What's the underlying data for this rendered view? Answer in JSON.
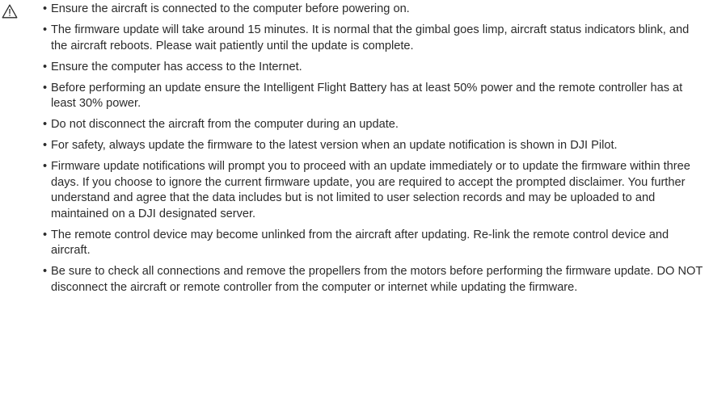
{
  "icon": "warning-triangle-icon",
  "notes": [
    "Ensure the aircraft is connected to the computer before powering on.",
    "The firmware update will take around 15 minutes. It is normal that the gimbal goes limp, aircraft status indicators blink, and the aircraft reboots. Please wait patiently until the update is complete.",
    "Ensure the computer has access to the Internet.",
    "Before performing an update ensure the Intelligent Flight Battery has at least 50% power and the remote controller has at least 30% power.",
    "Do not disconnect the aircraft from the computer during an update.",
    "For safety, always update the firmware to the latest version when an update notification is shown in DJI Pilot.",
    "Firmware update notifications will prompt you to proceed with an update immediately or to update the firmware within three days. If you choose to ignore the current firmware update, you are required to accept the prompted disclaimer. You further understand and agree that the data includes but is not limited to user selection records and may be uploaded to and maintained on a DJI designated server.",
    "The remote control device may become unlinked from the aircraft after updating. Re-link the remote control device and aircraft.",
    "Be sure to check all connections and remove the propellers from the motors before performing the firmware update. DO NOT disconnect the aircraft or remote controller from the computer or internet while updating the firmware."
  ]
}
